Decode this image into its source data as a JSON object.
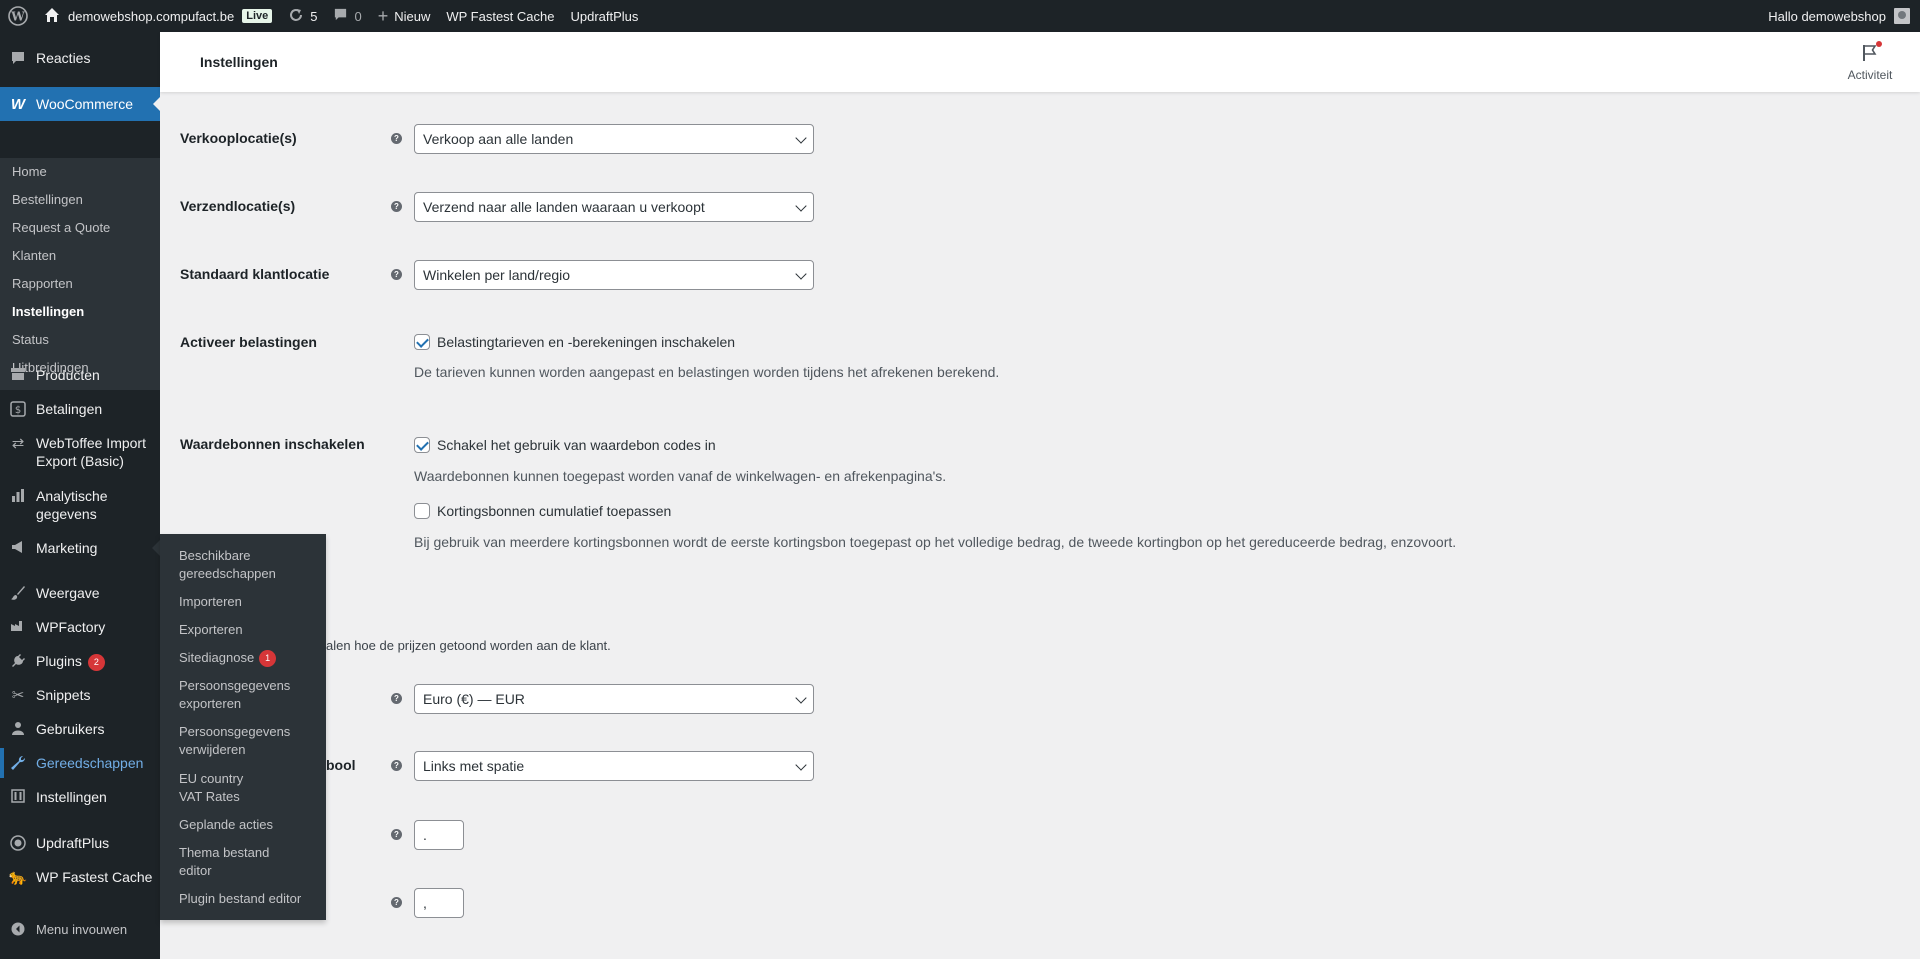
{
  "adminbar": {
    "site_name": "demowebshop.compufact.be",
    "live_badge": "Live",
    "updates_count": "5",
    "comments_count": "0",
    "new_label": "Nieuw",
    "wp_fastest_cache": "WP Fastest Cache",
    "updraftplus": "UpdraftPlus",
    "greeting": "Hallo demowebshop"
  },
  "header": {
    "title": "Instellingen",
    "activity_label": "Activiteit"
  },
  "sidebar": {
    "items": [
      {
        "label": "Reacties",
        "icon": "comment-icon"
      },
      {
        "label": "WooCommerce",
        "icon": "woocommerce-icon"
      },
      {
        "label": "Producten",
        "icon": "archive-icon"
      },
      {
        "label": "Betalingen",
        "icon": "dollar-icon"
      },
      {
        "label": "WebToffee Import Export (Basic)",
        "icon": "transfer-icon"
      },
      {
        "label": "Analytische gegevens",
        "icon": "chart-bar-icon"
      },
      {
        "label": "Marketing",
        "icon": "megaphone-icon"
      },
      {
        "label": "Weergave",
        "icon": "brush-icon"
      },
      {
        "label": "WPFactory",
        "icon": "factory-icon"
      },
      {
        "label": "Plugins",
        "icon": "plug-icon",
        "badge": "2"
      },
      {
        "label": "Snippets",
        "icon": "scissors-icon"
      },
      {
        "label": "Gebruikers",
        "icon": "user-icon"
      },
      {
        "label": "Gereedschappen",
        "icon": "wrench-icon"
      },
      {
        "label": "Instellingen",
        "icon": "settings-icon"
      },
      {
        "label": "UpdraftPlus",
        "icon": "updraft-icon"
      },
      {
        "label": "WP Fastest Cache",
        "icon": "cheetah-icon"
      },
      {
        "label": "Menu invouwen",
        "icon": "collapse-icon"
      }
    ],
    "woo_submenu": [
      "Home",
      "Bestellingen",
      "Request a Quote",
      "Klanten",
      "Rapporten",
      "Instellingen",
      "Status",
      "Uitbreidingen"
    ]
  },
  "flyout": {
    "items": [
      {
        "label": "Beschikbare gereedschappen"
      },
      {
        "label": "Importeren"
      },
      {
        "label": "Exporteren"
      },
      {
        "label": "Sitediagnose",
        "badge": "1"
      },
      {
        "label": "Persoonsgegevens exporteren"
      },
      {
        "label": "Persoonsgegevens verwijderen"
      },
      {
        "label": "EU country VAT Rates"
      },
      {
        "label": "Geplande acties"
      },
      {
        "label": "Thema bestand editor"
      },
      {
        "label": "Plugin bestand editor"
      }
    ]
  },
  "form": {
    "selling_locations": {
      "label": "Verkooplocatie(s)",
      "value": "Verkoop aan alle landen"
    },
    "shipping_locations": {
      "label": "Verzendlocatie(s)",
      "value": "Verzend naar alle landen waaraan u verkoopt"
    },
    "default_location": {
      "label": "Standaard klantlocatie",
      "value": "Winkelen per land/regio"
    },
    "enable_taxes": {
      "label": "Activeer belastingen",
      "checkbox_label": "Belastingtarieven en -berekeningen inschakelen",
      "description": "De tarieven kunnen worden aangepast en belastingen worden tijdens het afrekenen berekend."
    },
    "coupons": {
      "label": "Waardebonnen inschakelen",
      "checkbox_label": "Schakel het gebruik van waardebon codes in",
      "description": "Waardebonnen kunnen toegepast worden vanaf de winkelwagen- en afrekenpagina's.",
      "cumulative_label": "Kortingsbonnen cumulatief toepassen",
      "cumulative_description": "Bij gebruik van meerdere kortingsbonnen wordt de eerste kortingsbon toegepast op het volledige bedrag, de tweede kortingbon op het gereduceerde bedrag, enzovoort."
    },
    "currency_intro_partial": "alen hoe de prijzen getoond worden aan de klant.",
    "currency": {
      "value": "Euro (€) — EUR"
    },
    "currency_position": {
      "label_partial": "bool",
      "value": "Links met spatie"
    },
    "thousand_sep": {
      "value": "."
    },
    "decimal_sep": {
      "value": ","
    }
  }
}
